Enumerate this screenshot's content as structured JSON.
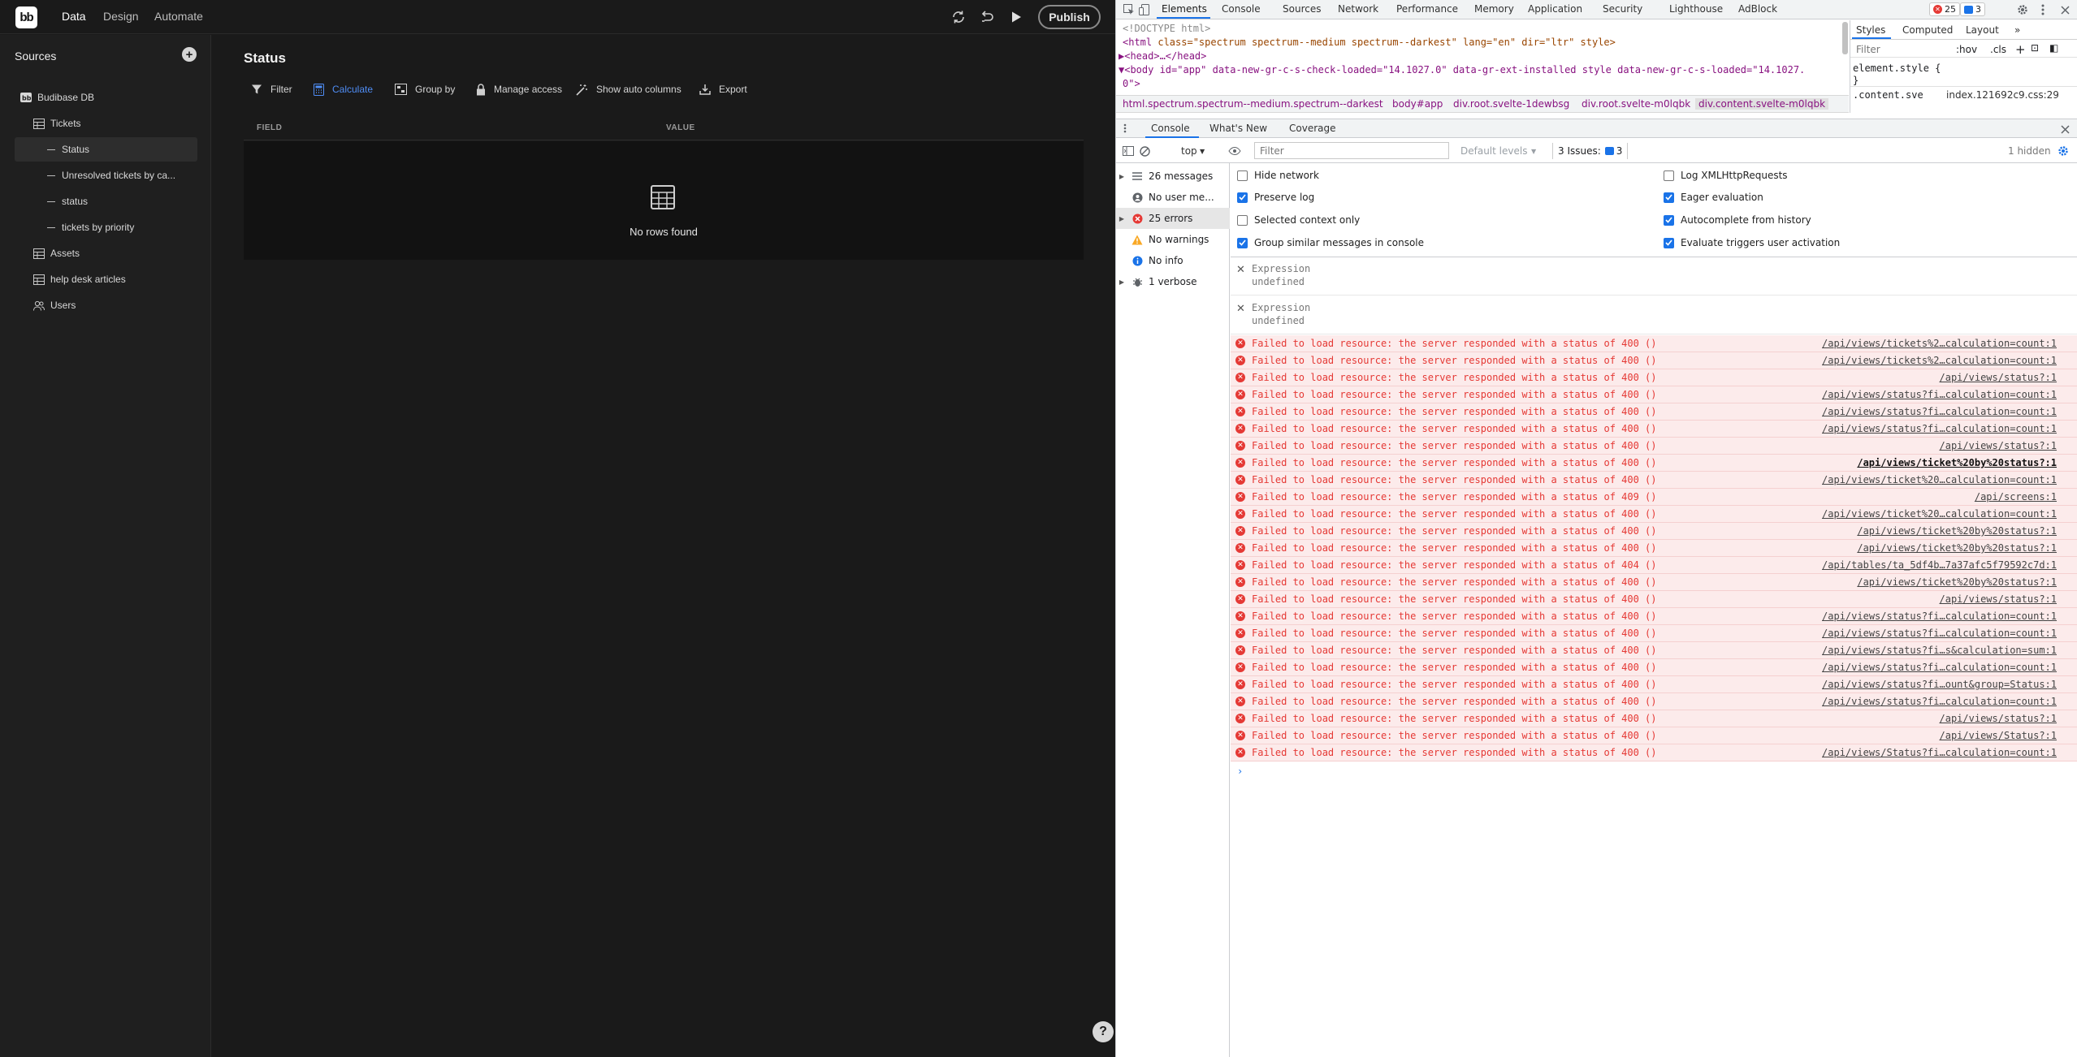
{
  "app": {
    "logo": "bb",
    "nav_tabs": [
      {
        "label": "Data",
        "active": true
      },
      {
        "label": "Design",
        "active": false
      },
      {
        "label": "Automate",
        "active": false
      }
    ],
    "publish_label": "Publish",
    "icons": [
      "refresh-icon",
      "undo-icon",
      "play-icon"
    ]
  },
  "sidebar": {
    "title": "Sources",
    "items": [
      {
        "label": "Budibase DB",
        "icon": "bb-icon",
        "indent": 0
      },
      {
        "label": "Tickets",
        "icon": "table-icon",
        "indent": 1
      },
      {
        "label": "Status",
        "icon": "view",
        "indent": 2,
        "selected": true
      },
      {
        "label": "Unresolved tickets by ca...",
        "icon": "view",
        "indent": 2
      },
      {
        "label": "status",
        "icon": "view",
        "indent": 2
      },
      {
        "label": "tickets by priority",
        "icon": "view",
        "indent": 2
      },
      {
        "label": "Assets",
        "icon": "table-icon",
        "indent": 1
      },
      {
        "label": "help desk articles",
        "icon": "table-icon",
        "indent": 1
      },
      {
        "label": "Users",
        "icon": "users-icon",
        "indent": 1
      }
    ]
  },
  "main": {
    "title": "Status",
    "toolbar": {
      "filter": "Filter",
      "calculate": "Calculate",
      "group_by": "Group by",
      "manage_access": "Manage access",
      "show_auto_columns": "Show auto columns",
      "export": "Export"
    },
    "columns": [
      "FIELD",
      "VALUE"
    ],
    "empty_text": "No rows found",
    "help_label": "?"
  },
  "devtools": {
    "tabs": [
      "Elements",
      "Console",
      "Sources",
      "Network",
      "Performance",
      "Memory",
      "Application",
      "Security",
      "Lighthouse",
      "AdBlock"
    ],
    "error_badge": "25",
    "message_badge": "3",
    "elements": {
      "doctype": "<!DOCTYPE html>",
      "html_tag": "<html",
      "html_attrs": " class=\"spectrum spectrum--medium spectrum--darkest\" lang=\"en\" dir=\"ltr\" style>",
      "head": "▶<head>…</head>",
      "body_line1": "▼<body id=\"app\" data-new-gr-c-s-check-loaded=\"14.1027.0\" data-gr-ext-installed style data-new-gr-c-s-loaded=\"14.1027.",
      "body_line2": "0\">"
    },
    "breadcrumbs": [
      "html.spectrum.spectrum--medium.spectrum--darkest",
      "body#app",
      "div.root.svelte-1dewbsg",
      "div.root.svelte-m0lqbk",
      "div.content.svelte-m0lqbk"
    ],
    "styles": {
      "tabs": [
        "Styles",
        "Computed",
        "Layout"
      ],
      "filter": "Filter",
      "hov": ":hov",
      "cls": ".cls",
      "rule1": "element.style {",
      "rule1_close": "}",
      "rule2": ".content.sve",
      "rule2_src": "index.121692c9.css:29"
    },
    "drawer_tabs": [
      "Console",
      "What's New",
      "Coverage"
    ],
    "console_toolbar": {
      "context": "top",
      "filter_placeholder": "Filter",
      "levels": "Default levels",
      "issues_label": "3 Issues:",
      "issues_count": "3",
      "hidden": "1 hidden"
    },
    "sidebar": [
      {
        "label": "26 messages",
        "icon": "list-icon"
      },
      {
        "label": "No user me...",
        "icon": "user-icon"
      },
      {
        "label": "25 errors",
        "icon": "error-icon",
        "selected": true
      },
      {
        "label": "No warnings",
        "icon": "warning-icon"
      },
      {
        "label": "No info",
        "icon": "info-icon"
      },
      {
        "label": "1 verbose",
        "icon": "bug-icon"
      }
    ],
    "settings": [
      {
        "label": "Hide network",
        "checked": false
      },
      {
        "label": "Log XMLHttpRequests",
        "checked": false
      },
      {
        "label": "Preserve log",
        "checked": true
      },
      {
        "label": "Eager evaluation",
        "checked": true
      },
      {
        "label": "Selected context only",
        "checked": false
      },
      {
        "label": "Autocomplete from history",
        "checked": true
      },
      {
        "label": "Group similar messages in console",
        "checked": true
      },
      {
        "label": "Evaluate triggers user activation",
        "checked": true
      }
    ],
    "expressions": [
      {
        "label": "Expression",
        "value": "undefined"
      },
      {
        "label": "Expression",
        "value": "undefined"
      }
    ],
    "errors": [
      {
        "msg": "Failed to load resource: the server responded with a status of 400 ()",
        "src": "/api/views/tickets%2…calculation=count:1"
      },
      {
        "msg": "Failed to load resource: the server responded with a status of 400 ()",
        "src": "/api/views/tickets%2…calculation=count:1"
      },
      {
        "msg": "Failed to load resource: the server responded with a status of 400 ()",
        "src": "/api/views/status?:1"
      },
      {
        "msg": "Failed to load resource: the server responded with a status of 400 ()",
        "src": "/api/views/status?fi…calculation=count:1"
      },
      {
        "msg": "Failed to load resource: the server responded with a status of 400 ()",
        "src": "/api/views/status?fi…calculation=count:1"
      },
      {
        "msg": "Failed to load resource: the server responded with a status of 400 ()",
        "src": "/api/views/status?fi…calculation=count:1"
      },
      {
        "msg": "Failed to load resource: the server responded with a status of 400 ()",
        "src": "/api/views/status?:1"
      },
      {
        "msg": "Failed to load resource: the server responded with a status of 400 ()",
        "src": "/api/views/ticket%20by%20status?:1",
        "bold": true
      },
      {
        "msg": "Failed to load resource: the server responded with a status of 400 ()",
        "src": "/api/views/ticket%20…calculation=count:1"
      },
      {
        "msg": "Failed to load resource: the server responded with a status of 409 ()",
        "src": "/api/screens:1"
      },
      {
        "msg": "Failed to load resource: the server responded with a status of 400 ()",
        "src": "/api/views/ticket%20…calculation=count:1"
      },
      {
        "msg": "Failed to load resource: the server responded with a status of 400 ()",
        "src": "/api/views/ticket%20by%20status?:1"
      },
      {
        "msg": "Failed to load resource: the server responded with a status of 400 ()",
        "src": "/api/views/ticket%20by%20status?:1"
      },
      {
        "msg": "Failed to load resource: the server responded with a status of 404 ()",
        "src": "/api/tables/ta_5df4b…7a37afc5f79592c7d:1"
      },
      {
        "msg": "Failed to load resource: the server responded with a status of 400 ()",
        "src": "/api/views/ticket%20by%20status?:1"
      },
      {
        "msg": "Failed to load resource: the server responded with a status of 400 ()",
        "src": "/api/views/status?:1"
      },
      {
        "msg": "Failed to load resource: the server responded with a status of 400 ()",
        "src": "/api/views/status?fi…calculation=count:1"
      },
      {
        "msg": "Failed to load resource: the server responded with a status of 400 ()",
        "src": "/api/views/status?fi…calculation=count:1"
      },
      {
        "msg": "Failed to load resource: the server responded with a status of 400 ()",
        "src": "/api/views/status?fi…s&calculation=sum:1"
      },
      {
        "msg": "Failed to load resource: the server responded with a status of 400 ()",
        "src": "/api/views/status?fi…calculation=count:1"
      },
      {
        "msg": "Failed to load resource: the server responded with a status of 400 ()",
        "src": "/api/views/status?fi…ount&group=Status:1"
      },
      {
        "msg": "Failed to load resource: the server responded with a status of 400 ()",
        "src": "/api/views/status?fi…calculation=count:1"
      },
      {
        "msg": "Failed to load resource: the server responded with a status of 400 ()",
        "src": "/api/views/status?:1"
      },
      {
        "msg": "Failed to load resource: the server responded with a status of 400 ()",
        "src": "/api/views/Status?:1"
      },
      {
        "msg": "Failed to load resource: the server responded with a status of 400 ()",
        "src": "/api/views/Status?fi…calculation=count:1"
      }
    ],
    "prompt": "›"
  }
}
